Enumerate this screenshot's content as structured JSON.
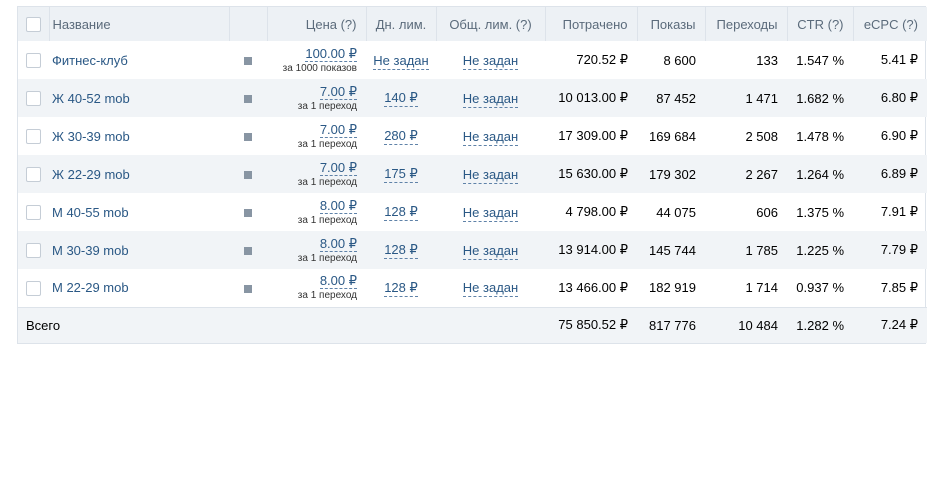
{
  "columns": {
    "name": "Название",
    "price": "Цена (?)",
    "day_limit": "Дн. лим.",
    "total_limit": "Общ. лим. (?)",
    "spent": "Потрачено",
    "impressions": "Показы",
    "clicks": "Переходы",
    "ctr": "CTR (?)",
    "ecpc": "eCPC (?)"
  },
  "rows": [
    {
      "name": "Фитнес-клуб",
      "price": "100.00 ₽",
      "price_note": "за 1000 показов",
      "day_limit": "Не задан",
      "total_limit": "Не задан",
      "spent": "720.52 ₽",
      "impressions": "8 600",
      "clicks": "133",
      "ctr": "1.547 %",
      "ecpc": "5.41 ₽"
    },
    {
      "name": "Ж 40-52 mob",
      "price": "7.00 ₽",
      "price_note": "за 1 переход",
      "day_limit": "140 ₽",
      "total_limit": "Не задан",
      "spent": "10 013.00 ₽",
      "impressions": "87 452",
      "clicks": "1 471",
      "ctr": "1.682 %",
      "ecpc": "6.80 ₽"
    },
    {
      "name": "Ж 30-39 mob",
      "price": "7.00 ₽",
      "price_note": "за 1 переход",
      "day_limit": "280 ₽",
      "total_limit": "Не задан",
      "spent": "17 309.00 ₽",
      "impressions": "169 684",
      "clicks": "2 508",
      "ctr": "1.478 %",
      "ecpc": "6.90 ₽"
    },
    {
      "name": "Ж 22-29 mob",
      "price": "7.00 ₽",
      "price_note": "за 1 переход",
      "day_limit": "175 ₽",
      "total_limit": "Не задан",
      "spent": "15 630.00 ₽",
      "impressions": "179 302",
      "clicks": "2 267",
      "ctr": "1.264 %",
      "ecpc": "6.89 ₽"
    },
    {
      "name": "М 40-55 mob",
      "price": "8.00 ₽",
      "price_note": "за 1 переход",
      "day_limit": "128 ₽",
      "total_limit": "Не задан",
      "spent": "4 798.00 ₽",
      "impressions": "44 075",
      "clicks": "606",
      "ctr": "1.375 %",
      "ecpc": "7.91 ₽"
    },
    {
      "name": "М 30-39 mob",
      "price": "8.00 ₽",
      "price_note": "за 1 переход",
      "day_limit": "128 ₽",
      "total_limit": "Не задан",
      "spent": "13 914.00 ₽",
      "impressions": "145 744",
      "clicks": "1 785",
      "ctr": "1.225 %",
      "ecpc": "7.79 ₽"
    },
    {
      "name": "М 22-29 mob",
      "price": "8.00 ₽",
      "price_note": "за 1 переход",
      "day_limit": "128 ₽",
      "total_limit": "Не задан",
      "spent": "13 466.00 ₽",
      "impressions": "182 919",
      "clicks": "1 714",
      "ctr": "0.937 %",
      "ecpc": "7.85 ₽"
    }
  ],
  "totals": {
    "label": "Всего",
    "spent": "75 850.52 ₽",
    "impressions": "817 776",
    "clicks": "10 484",
    "ctr": "1.282 %",
    "ecpc": "7.24 ₽"
  },
  "colors": {
    "header_bg": "#edf1f5",
    "alt_row_bg": "#f1f4f7",
    "link": "#2a5885",
    "status": "#8895a3"
  },
  "icons": {
    "row_status": "status-square-icon",
    "select": "checkbox"
  }
}
